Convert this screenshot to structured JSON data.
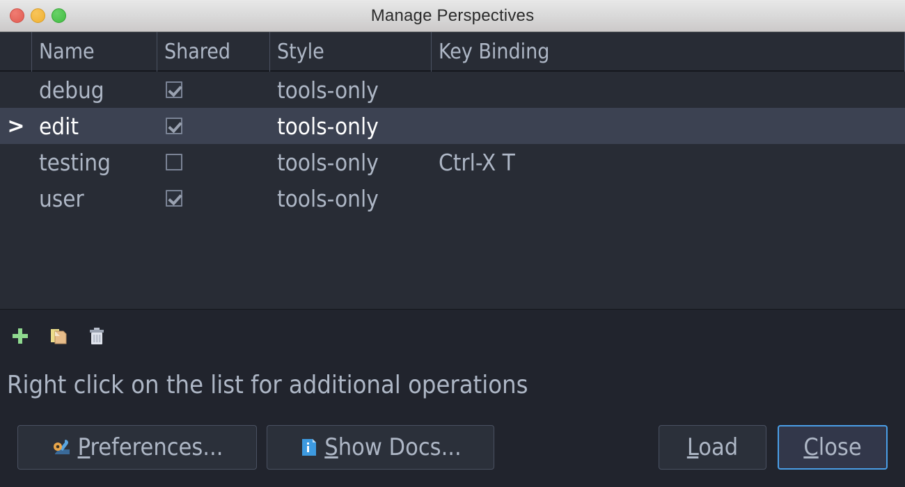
{
  "window": {
    "title": "Manage Perspectives",
    "traffic_lights": [
      {
        "name": "close-window-button",
        "color": "#e05c52"
      },
      {
        "name": "minimize-window-button",
        "color": "#f0b133"
      },
      {
        "name": "maximize-window-button",
        "color": "#43bd43"
      }
    ]
  },
  "table": {
    "columns": [
      {
        "key": "marker",
        "label": ""
      },
      {
        "key": "name",
        "label": "Name"
      },
      {
        "key": "shared",
        "label": "Shared"
      },
      {
        "key": "style",
        "label": "Style"
      },
      {
        "key": "key_binding",
        "label": "Key Binding"
      }
    ],
    "rows": [
      {
        "marker": "",
        "name": "debug",
        "shared": true,
        "style": "tools-only",
        "key_binding": "",
        "selected": false
      },
      {
        "marker": ">",
        "name": "edit",
        "shared": true,
        "style": "tools-only",
        "key_binding": "",
        "selected": true
      },
      {
        "marker": "",
        "name": "testing",
        "shared": false,
        "style": "tools-only",
        "key_binding": "Ctrl-X T",
        "selected": false
      },
      {
        "marker": "",
        "name": "user",
        "shared": true,
        "style": "tools-only",
        "key_binding": "",
        "selected": false
      }
    ]
  },
  "toolbar": {
    "items": [
      {
        "name": "add-perspective-button",
        "icon": "plus-icon",
        "color": "#8fd98f"
      },
      {
        "name": "copy-perspective-button",
        "icon": "copy-document-icon",
        "color": "#e8bd8a"
      },
      {
        "name": "delete-perspective-button",
        "icon": "trash-icon",
        "color": "#c3c8d4"
      }
    ]
  },
  "hint": {
    "text": "Right click on the list for additional operations"
  },
  "buttons": {
    "preferences": {
      "label_before": "",
      "mnemonic": "P",
      "label_after": "references...",
      "icon": "preferences-tools-icon",
      "focused": false
    },
    "show_docs": {
      "label_before": "",
      "mnemonic": "S",
      "label_after": "how Docs...",
      "icon": "info-document-icon",
      "focused": false
    },
    "load": {
      "label_before": "",
      "mnemonic": "L",
      "label_after": "oad",
      "focused": false
    },
    "close": {
      "label_before": "",
      "mnemonic": "C",
      "label_after": "lose",
      "focused": true
    }
  },
  "colors": {
    "titlebar_bg": "#d8d8d8",
    "list_bg": "#282c35",
    "panel_bg": "#21242d",
    "selected_row_bg": "#3c4252",
    "text": "#aeb7c6",
    "focus_border": "#4a9fe8"
  }
}
